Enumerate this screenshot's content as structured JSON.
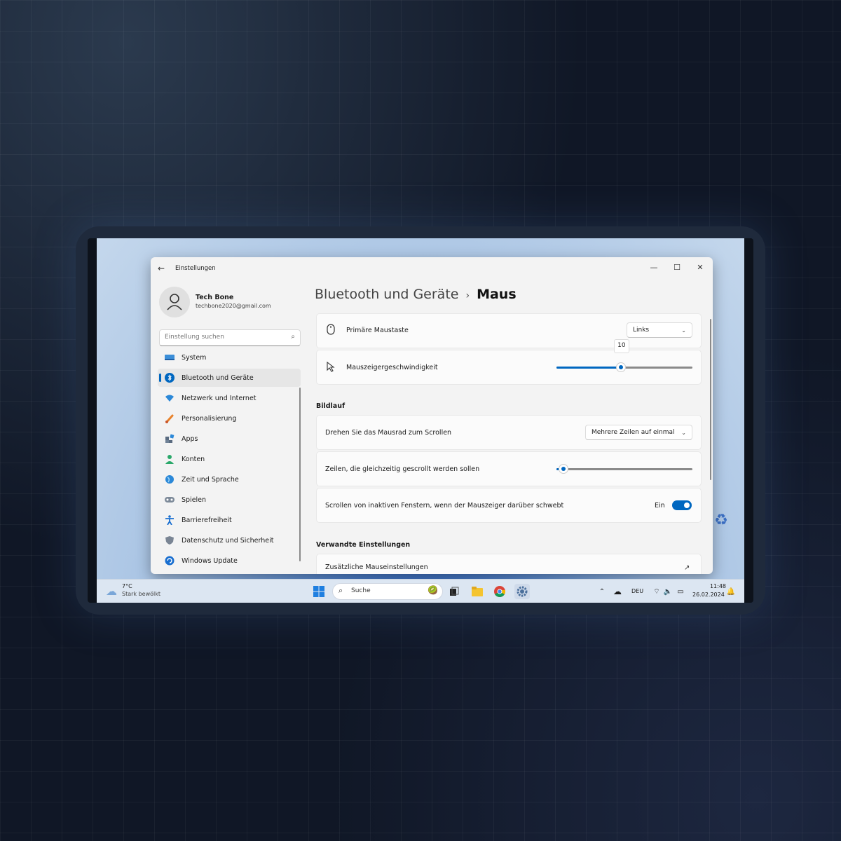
{
  "window": {
    "title": "Einstellungen",
    "controls": {
      "minimize": "—",
      "maximize": "☐",
      "close": "✕"
    }
  },
  "profile": {
    "name": "Tech Bone",
    "email": "techbone2020@gmail.com"
  },
  "search": {
    "placeholder": "Einstellung suchen"
  },
  "sidebar": {
    "items": [
      {
        "label": "System",
        "icon": "system-icon"
      },
      {
        "label": "Bluetooth und Geräte",
        "icon": "bluetooth-icon",
        "active": true
      },
      {
        "label": "Netzwerk und Internet",
        "icon": "wifi-icon"
      },
      {
        "label": "Personalisierung",
        "icon": "brush-icon"
      },
      {
        "label": "Apps",
        "icon": "apps-icon"
      },
      {
        "label": "Konten",
        "icon": "account-icon"
      },
      {
        "label": "Zeit und Sprache",
        "icon": "globe-icon"
      },
      {
        "label": "Spielen",
        "icon": "gamepad-icon"
      },
      {
        "label": "Barrierefreiheit",
        "icon": "accessibility-icon"
      },
      {
        "label": "Datenschutz und Sicherheit",
        "icon": "shield-icon"
      },
      {
        "label": "Windows Update",
        "icon": "update-icon"
      }
    ]
  },
  "breadcrumb": {
    "parent": "Bluetooth und Geräte",
    "separator": "›",
    "current": "Maus"
  },
  "mouse": {
    "primary_button": {
      "label": "Primäre Maustaste",
      "value": "Links"
    },
    "pointer_speed": {
      "label": "Mauszeigergeschwindigkeit",
      "value": 10,
      "min": 1,
      "max": 20,
      "tooltip": "10"
    }
  },
  "scrolling": {
    "title": "Bildlauf",
    "wheel": {
      "label": "Drehen Sie das Mausrad zum Scrollen",
      "value": "Mehrere Zeilen auf einmal"
    },
    "lines": {
      "label": "Zeilen, die gleichzeitig gescrollt werden sollen",
      "value_fraction": 0.05
    },
    "inactive": {
      "label": "Scrollen von inaktiven Fenstern, wenn der Mauszeiger darüber schwebt",
      "state": "Ein",
      "on": true
    }
  },
  "related": {
    "title": "Verwandte Einstellungen",
    "extra": {
      "label": "Zusätzliche Mauseinstellungen"
    }
  },
  "taskbar": {
    "weather": {
      "temp": "7°C",
      "desc": "Stark bewölkt"
    },
    "search_label": "Suche",
    "language": "DEU",
    "time": "11:48",
    "date": "26.02.2024"
  },
  "colors": {
    "accent": "#0067c0"
  }
}
